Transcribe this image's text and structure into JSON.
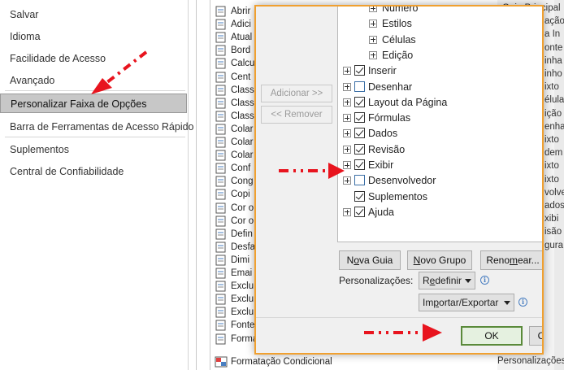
{
  "nav": {
    "items": [
      "Salvar",
      "Idioma",
      "Facilidade de Acesso",
      "Avançado",
      "Personalizar Faixa de Opções",
      "Barra de Ferramentas de Acesso Rápido",
      "Suplementos",
      "Central de Confiabilidade"
    ],
    "selected_index": 4
  },
  "commands": {
    "items": [
      "Abrir",
      "Adici",
      "Atual",
      "Bord",
      "Calcu",
      "Cent",
      "Class",
      "Class",
      "Class",
      "Colar",
      "Colar",
      "Colar",
      "Conf",
      "Cong",
      "Copi",
      "Cor o",
      "Cor o",
      "Defin",
      "Desfa",
      "Dimi",
      "Emai",
      "Exclu",
      "Exclu",
      "Exclu",
      "Fonte",
      "Forma"
    ],
    "bottom": "Formatação Condicional"
  },
  "right_column": {
    "texts": [
      "Guia Principal",
      "ação",
      "a In",
      "onte",
      "inha",
      "inho",
      "ixto",
      "élula",
      "ição",
      "enha",
      "ixto",
      "dem",
      "ixto",
      "ixto",
      "volve",
      "ados",
      "xibi",
      "isão",
      "gura",
      "Personalizações"
    ]
  },
  "dialog": {
    "add_button": "Adicionar >>",
    "remove_button": "<< Remover",
    "tree": [
      {
        "label": "Número",
        "level": 2,
        "expand": true,
        "check": null
      },
      {
        "label": "Estilos",
        "level": 2,
        "expand": true,
        "check": null
      },
      {
        "label": "Células",
        "level": 2,
        "expand": true,
        "check": null
      },
      {
        "label": "Edição",
        "level": 2,
        "expand": true,
        "check": null
      },
      {
        "label": "Inserir",
        "level": 1,
        "expand": true,
        "check": true
      },
      {
        "label": "Desenhar",
        "level": 1,
        "expand": true,
        "check": false
      },
      {
        "label": "Layout da Página",
        "level": 1,
        "expand": true,
        "check": true
      },
      {
        "label": "Fórmulas",
        "level": 1,
        "expand": true,
        "check": true
      },
      {
        "label": "Dados",
        "level": 1,
        "expand": true,
        "check": true
      },
      {
        "label": "Revisão",
        "level": 1,
        "expand": true,
        "check": true
      },
      {
        "label": "Exibir",
        "level": 1,
        "expand": true,
        "check": true
      },
      {
        "label": "Desenvolvedor",
        "level": 1,
        "expand": true,
        "check": false
      },
      {
        "label": "Suplementos",
        "level": 1,
        "expand": false,
        "check": true
      },
      {
        "label": "Ajuda",
        "level": 1,
        "expand": true,
        "check": true
      }
    ],
    "new_tab_button": {
      "pre": "N",
      "u": "o",
      "post": "va Guia"
    },
    "new_group_button": {
      "pre": "",
      "u": "N",
      "post": "ovo Grupo"
    },
    "rename_button": {
      "pre": "Reno",
      "u": "m",
      "post": "ear..."
    },
    "customizations_label": "Personalizações:",
    "reset_dropdown": {
      "pre": "R",
      "u": "e",
      "post": "definir"
    },
    "import_export_dropdown": {
      "pre": "Im",
      "u": "p",
      "post": "ortar/Exportar"
    },
    "ok_button": "OK",
    "cancel_button": "C"
  },
  "colors": {
    "highlight_arrow": "#e8141e",
    "dialog_border": "#f0a030",
    "ok_border": "#5a8a3a"
  }
}
